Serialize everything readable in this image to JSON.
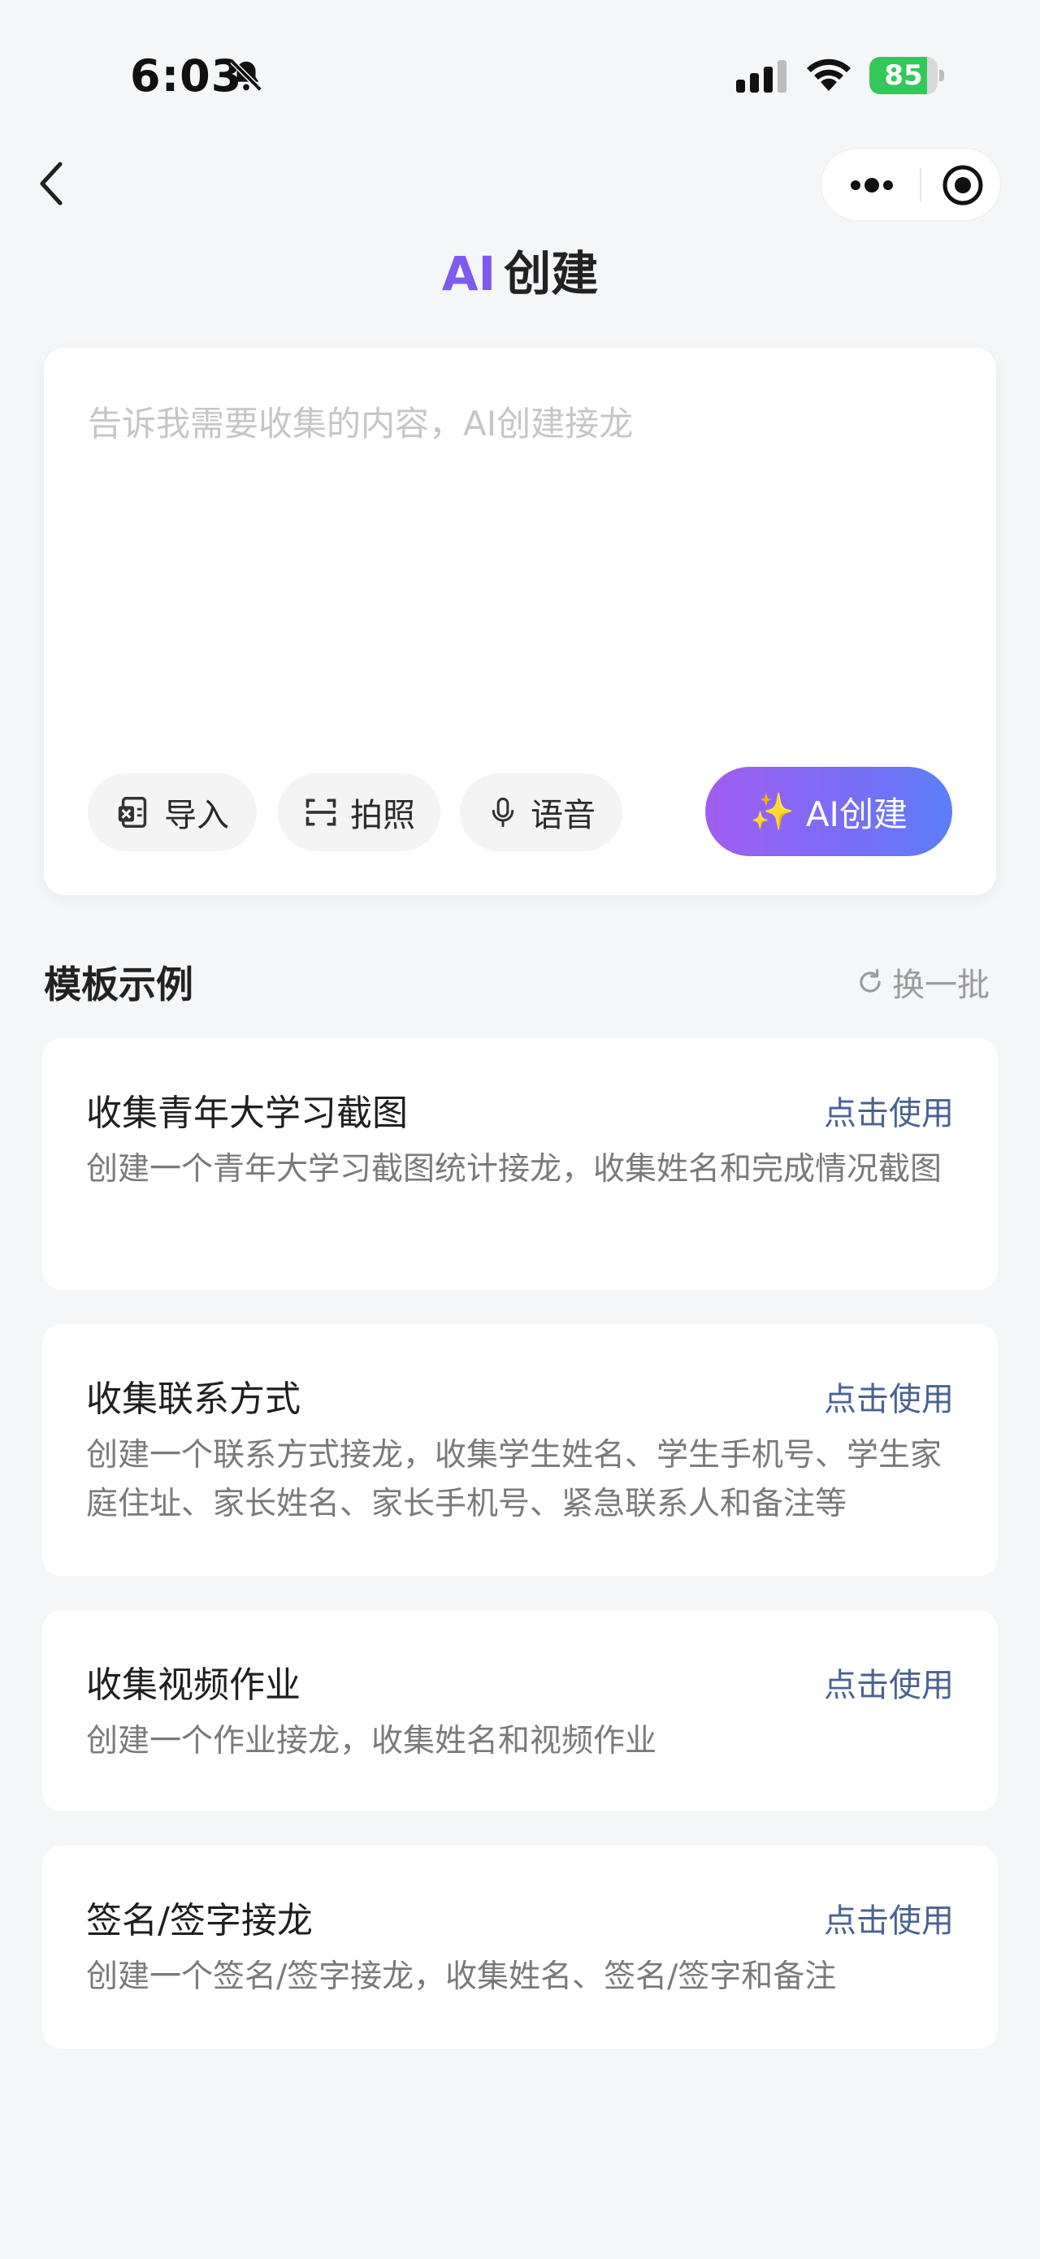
{
  "status_bar": {
    "time": "6:03",
    "battery": "85",
    "battery_level": 0.85
  },
  "header": {
    "title_ai": "AI",
    "title_rest": "创建"
  },
  "input": {
    "placeholder": "告诉我需要收集的内容，AI创建接龙",
    "value": ""
  },
  "toolbar": {
    "import_label": "导入",
    "photo_label": "拍照",
    "voice_label": "语音",
    "ai_create_label": "AI创建",
    "ai_create_icon": "✨"
  },
  "templates": {
    "section_title": "模板示例",
    "refresh_label": "换一批",
    "items": [
      {
        "title": "收集青年大学习截图",
        "action": "点击使用",
        "description": "创建一个青年大学习截图统计接龙，收集姓名和完成情况截图"
      },
      {
        "title": "收集联系方式",
        "action": "点击使用",
        "description": "创建一个联系方式接龙，收集学生姓名、学生手机号、学生家庭住址、家长姓名、家长手机号、紧急联系人和备注等"
      },
      {
        "title": "收集视频作业",
        "action": "点击使用",
        "description": "创建一个作业接龙，收集姓名和视频作业"
      },
      {
        "title": "签名/签字接龙",
        "action": "点击使用",
        "description": "创建一个签名/签字接龙，收集姓名、签名/签字和备注"
      }
    ]
  },
  "colors": {
    "accent_purple": "#7f5af0",
    "gradient_start": "#a15ef0",
    "gradient_end": "#5b7ff8",
    "link_blue": "#4a6390",
    "battery_green": "#34c759"
  }
}
